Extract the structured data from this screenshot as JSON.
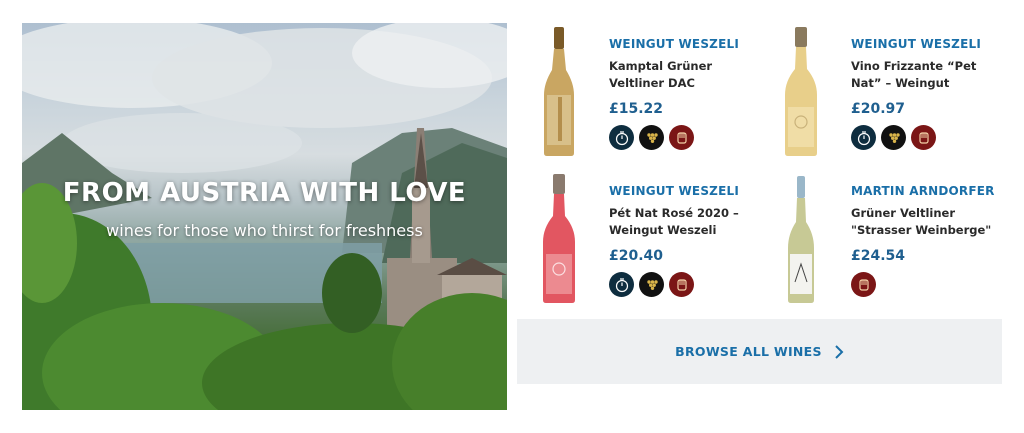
{
  "hero": {
    "title": "FROM AUSTRIA WITH LOVE",
    "subtitle": "wines for those who thirst for freshness"
  },
  "products": [
    {
      "producer": "WEINGUT WESZELI",
      "name": "Kamptal Grüner Veltliner DAC",
      "price": "£15.22",
      "bottle": {
        "glass": "#c9a662",
        "label": "#d8c08a",
        "capsule": "#7a5a28"
      },
      "badges": [
        "clock-icon",
        "grapes-icon",
        "fist-icon"
      ]
    },
    {
      "producer": "WEINGUT WESZELI",
      "name": "Vino Frizzante “Pet Nat” – Weingut",
      "price": "£20.97",
      "bottle": {
        "glass": "#e8cf8a",
        "label": "#f0dda6",
        "capsule": "#8a7a5e"
      },
      "badges": [
        "clock-icon",
        "grapes-icon",
        "fist-icon"
      ]
    },
    {
      "producer": "WEINGUT WESZELI",
      "name": "Pét Nat Rosé 2020 – Weingut Weszeli",
      "price": "£20.40",
      "bottle": {
        "glass": "#e25661",
        "label": "#ec8a90",
        "capsule": "#8a7a6e"
      },
      "badges": [
        "clock-icon",
        "grapes-icon",
        "fist-icon"
      ]
    },
    {
      "producer": "MARTIN ARNDORFER",
      "name": "Grüner Veltliner \"Strasser Weinberge\"",
      "price": "£24.54",
      "bottle": {
        "glass": "#c7c995",
        "label": "#f3f3ef",
        "capsule": "#9ab7c9"
      },
      "badges": [
        "fist-icon"
      ]
    }
  ],
  "browse": {
    "label": "BROWSE ALL WINES"
  },
  "colors": {
    "producer": "#1a6fa8",
    "price": "#1f5f8f",
    "navy_badge": "#0e2d3f",
    "black_badge": "#111111",
    "maroon_badge": "#7b1616",
    "browse_bg": "#eef0f2"
  }
}
